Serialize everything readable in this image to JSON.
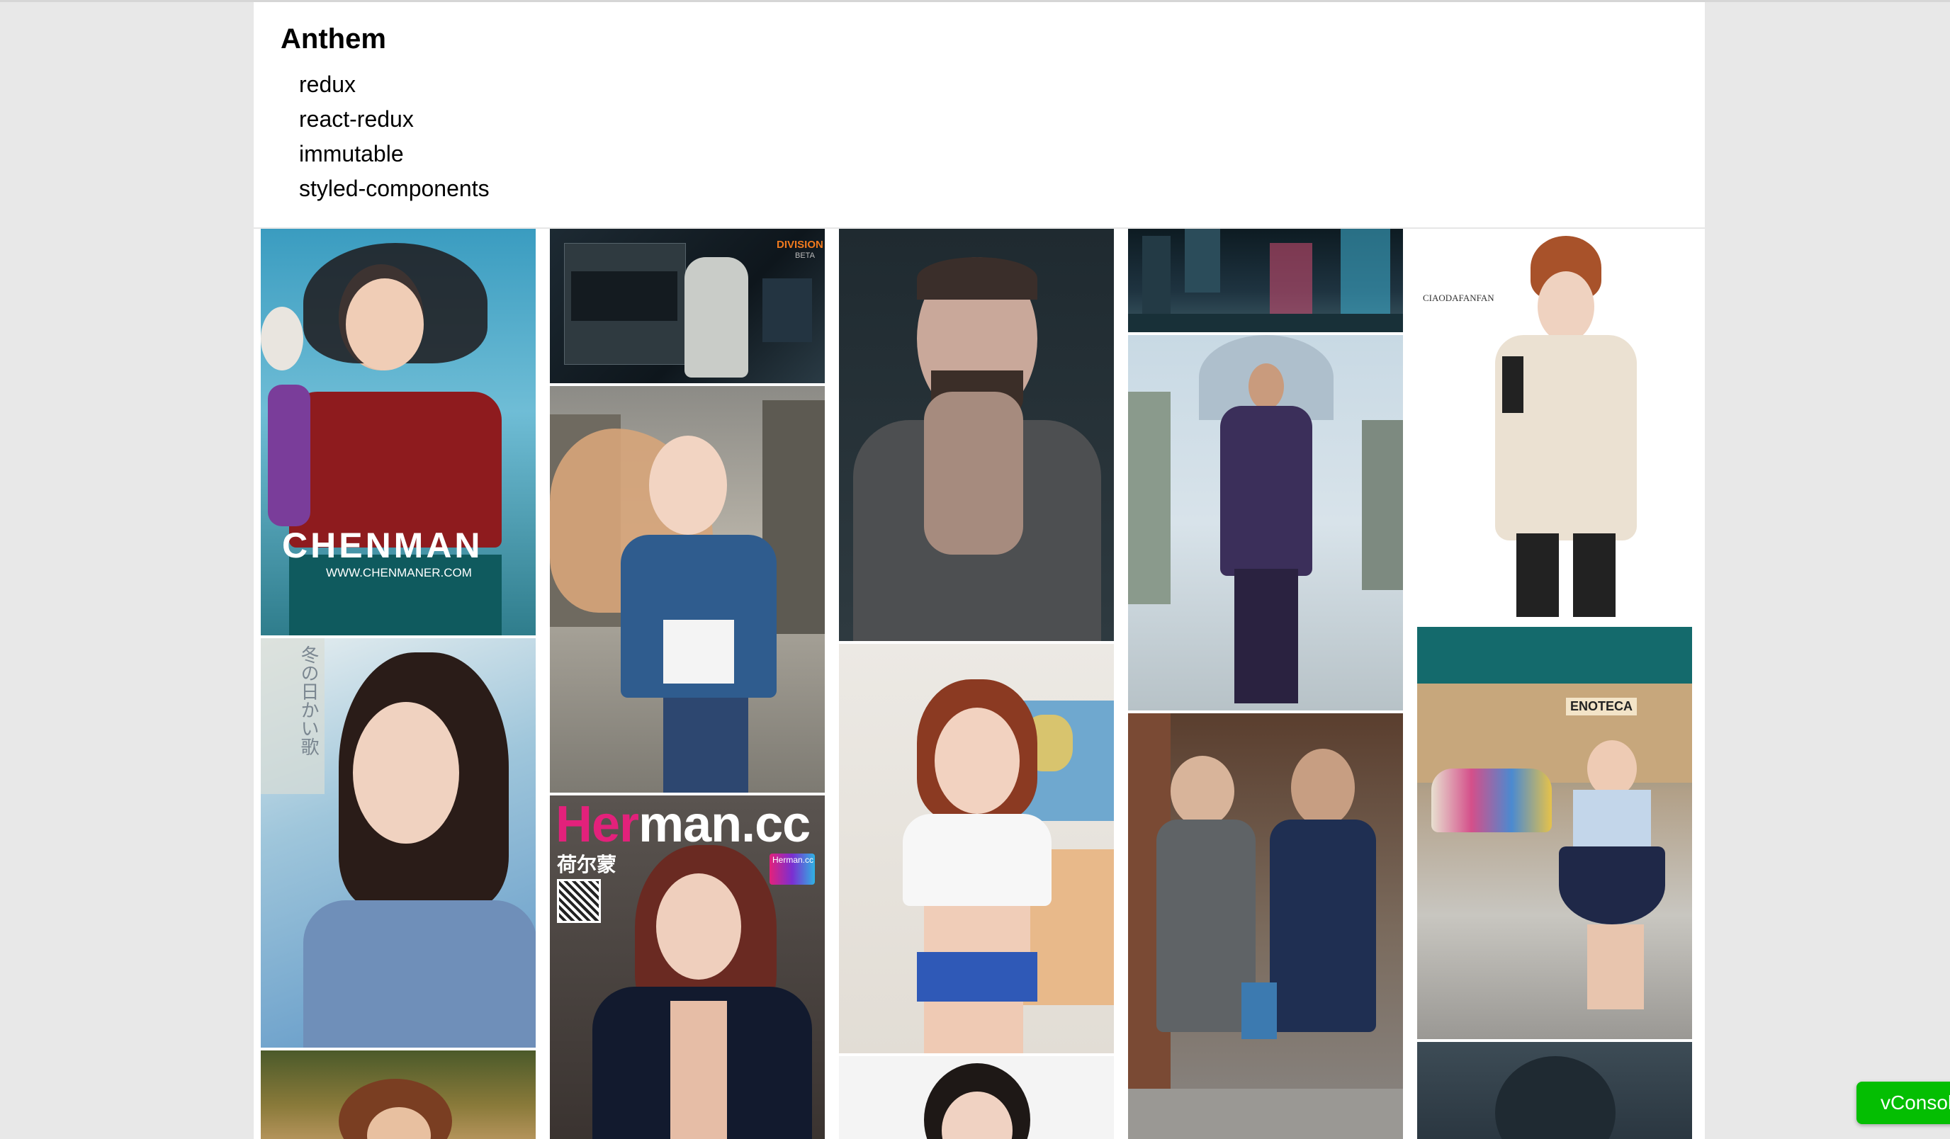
{
  "header": {
    "title": "Anthem",
    "dependencies": [
      "redux",
      "react-redux",
      "immutable",
      "styled-components"
    ]
  },
  "photos": {
    "chenman": {
      "brand": "CHENMAN",
      "url": "WWW.CHENMANER.COM"
    },
    "division": {
      "badge": "DIVISION",
      "beta": "BETA"
    },
    "herman": {
      "brand_a": "Her",
      "brand_b": "man.cc",
      "cn": "荷尔蒙",
      "badge": "Herman.cc"
    },
    "ciao": {
      "brand": "CIAODAFANFAN"
    },
    "japanese": {
      "vertical": "冬の日かい歌"
    },
    "enoteca": {
      "sign": "ENOTECA"
    }
  },
  "vconsole": {
    "label": "vConsole"
  }
}
